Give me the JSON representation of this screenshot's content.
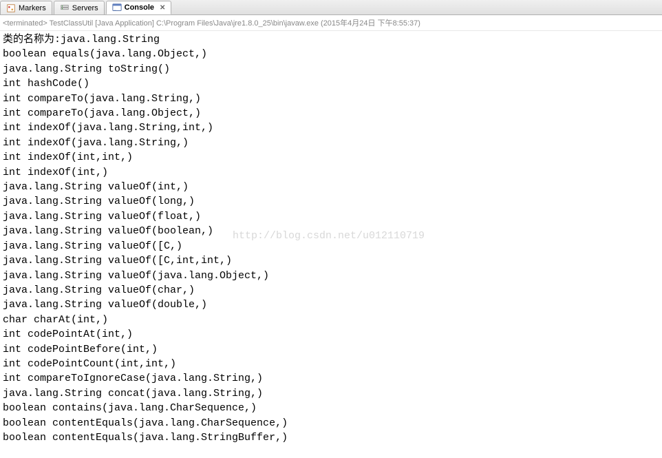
{
  "tabs": [
    {
      "label": "Markers",
      "active": false
    },
    {
      "label": "Servers",
      "active": false
    },
    {
      "label": "Console",
      "active": true
    }
  ],
  "terminated_text": "<terminated> TestClassUtil [Java Application] C:\\Program Files\\Java\\jre1.8.0_25\\bin\\javaw.exe (2015年4月24日 下午8:55:37)",
  "watermark": "http://blog.csdn.net/u012110719",
  "console_lines": [
    "类的名称为:java.lang.String",
    "boolean equals(java.lang.Object,)",
    "java.lang.String toString()",
    "int hashCode()",
    "int compareTo(java.lang.String,)",
    "int compareTo(java.lang.Object,)",
    "int indexOf(java.lang.String,int,)",
    "int indexOf(java.lang.String,)",
    "int indexOf(int,int,)",
    "int indexOf(int,)",
    "java.lang.String valueOf(int,)",
    "java.lang.String valueOf(long,)",
    "java.lang.String valueOf(float,)",
    "java.lang.String valueOf(boolean,)",
    "java.lang.String valueOf([C,)",
    "java.lang.String valueOf([C,int,int,)",
    "java.lang.String valueOf(java.lang.Object,)",
    "java.lang.String valueOf(char,)",
    "java.lang.String valueOf(double,)",
    "char charAt(int,)",
    "int codePointAt(int,)",
    "int codePointBefore(int,)",
    "int codePointCount(int,int,)",
    "int compareToIgnoreCase(java.lang.String,)",
    "java.lang.String concat(java.lang.String,)",
    "boolean contains(java.lang.CharSequence,)",
    "boolean contentEquals(java.lang.CharSequence,)",
    "boolean contentEquals(java.lang.StringBuffer,)"
  ]
}
